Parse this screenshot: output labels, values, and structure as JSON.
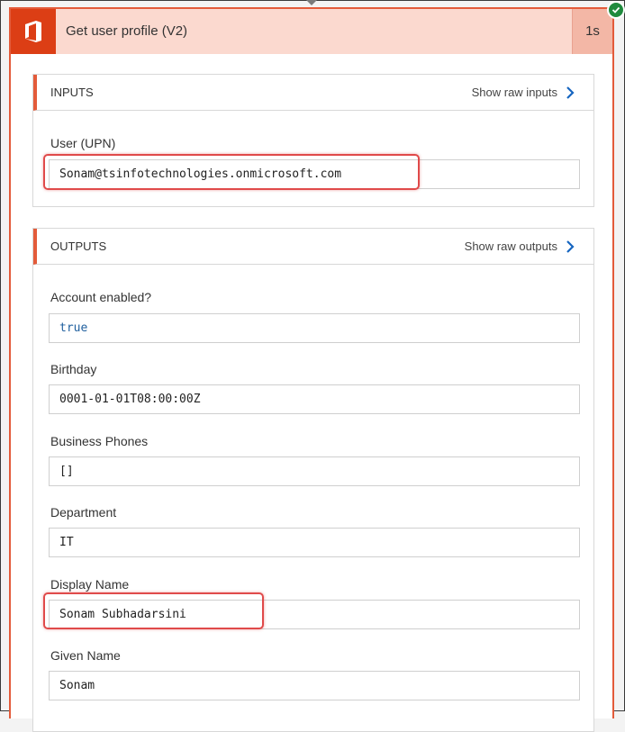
{
  "action": {
    "title": "Get user profile (V2)",
    "duration": "1s",
    "icon": "office-logo-icon",
    "status_icon": "success-check-icon",
    "colors": {
      "accent": "#e35b3a",
      "header_bg": "#fbd9cf",
      "office_red": "#dc3e15",
      "success": "#1f8a3d"
    }
  },
  "inputs": {
    "title": "INPUTS",
    "raw_link": "Show raw inputs",
    "fields": [
      {
        "label": "User (UPN)",
        "value": "Sonam@tsinfotechnologies.onmicrosoft.com"
      }
    ]
  },
  "outputs": {
    "title": "OUTPUTS",
    "raw_link": "Show raw outputs",
    "fields": [
      {
        "label": "Account enabled?",
        "value": "true"
      },
      {
        "label": "Birthday",
        "value": "0001-01-01T08:00:00Z"
      },
      {
        "label": "Business Phones",
        "value": "[]"
      },
      {
        "label": "Department",
        "value": "IT"
      },
      {
        "label": "Display Name",
        "value": "Sonam Subhadarsini"
      },
      {
        "label": "Given Name",
        "value": "Sonam"
      }
    ]
  }
}
